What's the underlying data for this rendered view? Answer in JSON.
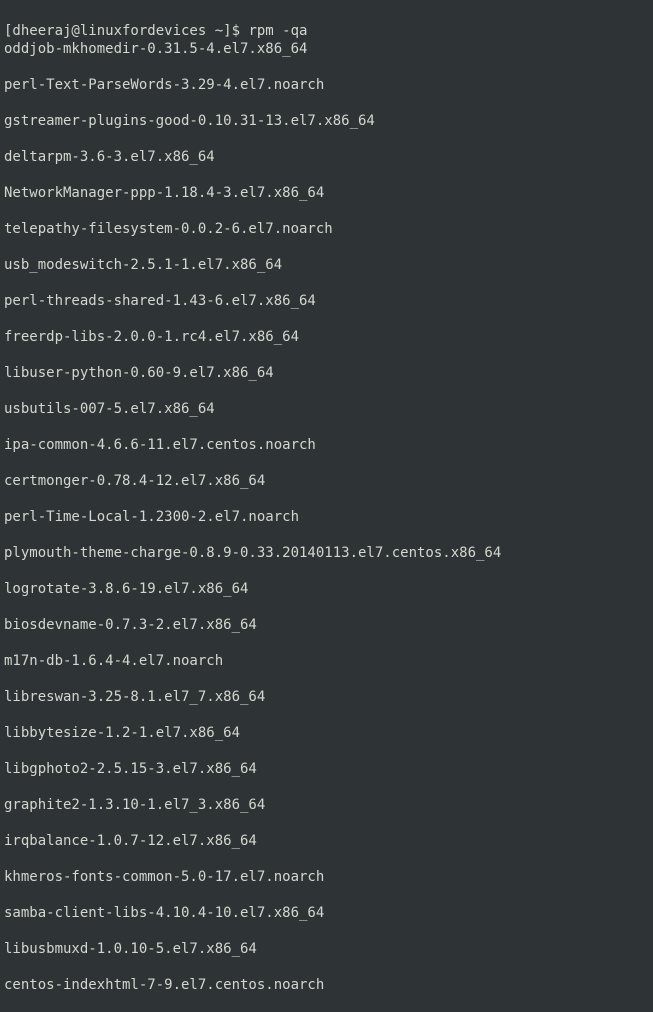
{
  "terminal": {
    "prompt": "[dheeraj@linuxfordevices ~]$ ",
    "command": "rpm -qa",
    "output": [
      "oddjob-mkhomedir-0.31.5-4.el7.x86_64",
      "perl-Text-ParseWords-3.29-4.el7.noarch",
      "gstreamer-plugins-good-0.10.31-13.el7.x86_64",
      "deltarpm-3.6-3.el7.x86_64",
      "NetworkManager-ppp-1.18.4-3.el7.x86_64",
      "telepathy-filesystem-0.0.2-6.el7.noarch",
      "usb_modeswitch-2.5.1-1.el7.x86_64",
      "perl-threads-shared-1.43-6.el7.x86_64",
      "freerdp-libs-2.0.0-1.rc4.el7.x86_64",
      "libuser-python-0.60-9.el7.x86_64",
      "usbutils-007-5.el7.x86_64",
      "ipa-common-4.6.6-11.el7.centos.noarch",
      "certmonger-0.78.4-12.el7.x86_64",
      "perl-Time-Local-1.2300-2.el7.noarch",
      "plymouth-theme-charge-0.8.9-0.33.20140113.el7.centos.x86_64",
      "logrotate-3.8.6-19.el7.x86_64",
      "biosdevname-0.7.3-2.el7.x86_64",
      "m17n-db-1.6.4-4.el7.noarch",
      "libreswan-3.25-8.1.el7_7.x86_64",
      "libbytesize-1.2-1.el7.x86_64",
      "libgphoto2-2.5.15-3.el7.x86_64",
      "graphite2-1.3.10-1.el7_3.x86_64",
      "irqbalance-1.0.7-12.el7.x86_64",
      "khmeros-fonts-common-5.0-17.el7.noarch",
      "samba-client-libs-4.10.4-10.el7.x86_64",
      "libusbmuxd-1.0.10-5.el7.x86_64",
      "centos-indexhtml-7-9.el7.centos.noarch"
    ]
  }
}
